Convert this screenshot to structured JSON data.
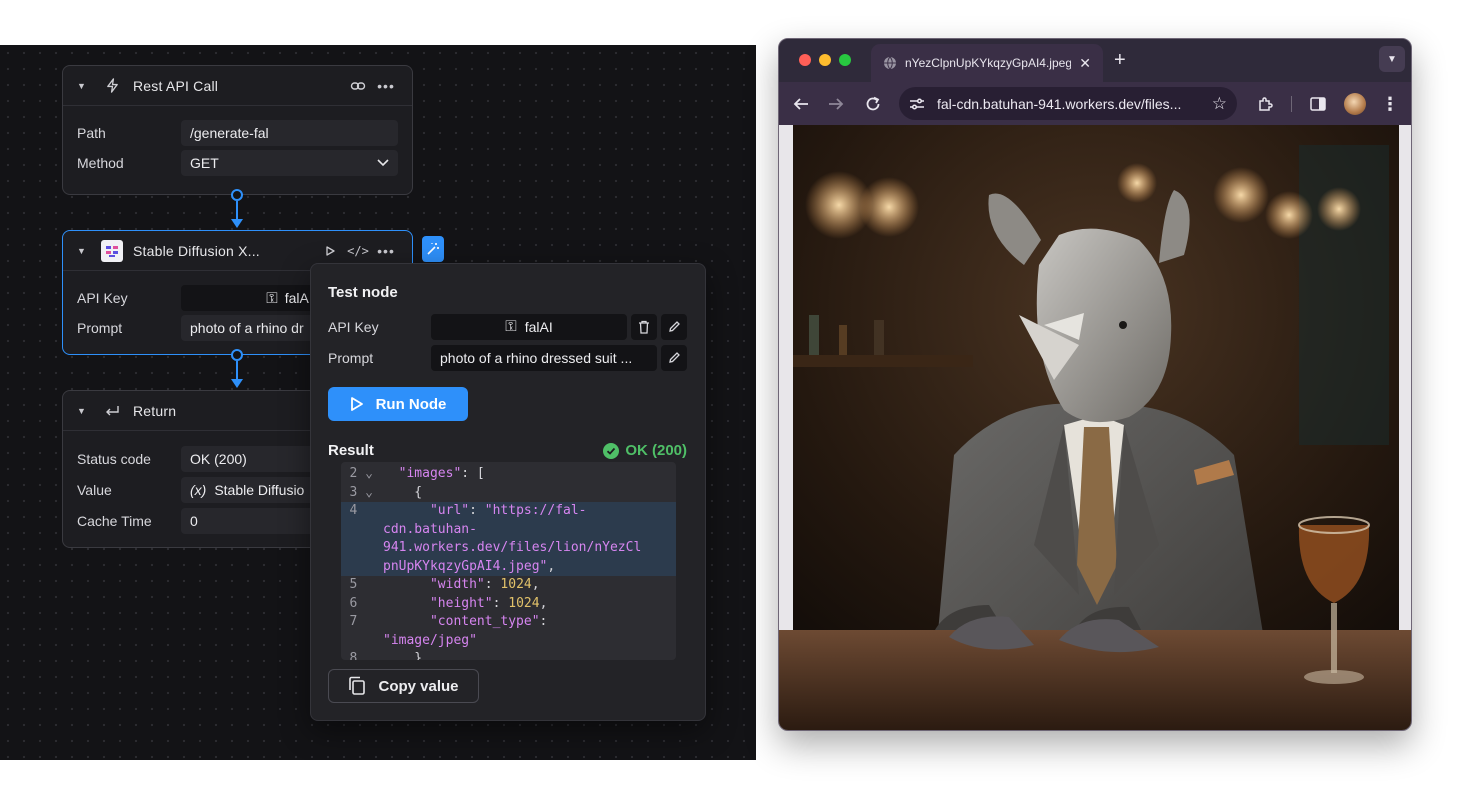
{
  "editor": {
    "rest_node": {
      "title": "Rest API Call",
      "fields": {
        "path_label": "Path",
        "path_value": "/generate-fal",
        "method_label": "Method",
        "method_value": "GET"
      }
    },
    "sd_node": {
      "title": "Stable Diffusion X...",
      "fields": {
        "apikey_label": "API Key",
        "apikey_value": "falAI",
        "prompt_label": "Prompt",
        "prompt_value": "photo of a rhino dr"
      }
    },
    "return_node": {
      "title": "Return",
      "fields": {
        "status_label": "Status code",
        "status_value": "OK (200)",
        "value_label": "Value",
        "value_value": "Stable Diffusio",
        "cache_label": "Cache Time",
        "cache_value": "0"
      }
    }
  },
  "test_panel": {
    "title": "Test node",
    "apikey_label": "API Key",
    "apikey_value": "falAI",
    "prompt_label": "Prompt",
    "prompt_value": "photo of a rhino dressed suit ...",
    "run_label": "Run Node",
    "result_label": "Result",
    "status": "OK (200)",
    "copy_label": "Copy value",
    "code_lines": [
      {
        "n": "2",
        "fold": true,
        "parts": [
          [
            "p",
            "  "
          ],
          [
            "k",
            "\"images\""
          ],
          [
            "p",
            ": ["
          ]
        ]
      },
      {
        "n": "3",
        "fold": true,
        "parts": [
          [
            "p",
            "    {"
          ]
        ]
      },
      {
        "n": "4",
        "parts": [
          [
            "p",
            "      "
          ],
          [
            "k",
            "\"url\""
          ],
          [
            "p",
            ": "
          ],
          [
            "s",
            "\"https://fal-"
          ]
        ],
        "hl": true
      },
      {
        "n": "",
        "parts": [
          [
            "s",
            "cdn.batuhan-"
          ]
        ],
        "hl": true
      },
      {
        "n": "",
        "parts": [
          [
            "s",
            "941.workers.dev/files/lion/nYezCl"
          ]
        ],
        "hl": true
      },
      {
        "n": "",
        "parts": [
          [
            "s",
            "pnUpKYkqzyGpAI4.jpeg\""
          ],
          [
            "p",
            ","
          ]
        ],
        "hl": true
      },
      {
        "n": "5",
        "parts": [
          [
            "p",
            "      "
          ],
          [
            "k",
            "\"width\""
          ],
          [
            "p",
            ": "
          ],
          [
            "n",
            "1024"
          ],
          [
            "p",
            ","
          ]
        ]
      },
      {
        "n": "6",
        "parts": [
          [
            "p",
            "      "
          ],
          [
            "k",
            "\"height\""
          ],
          [
            "p",
            ": "
          ],
          [
            "n",
            "1024"
          ],
          [
            "p",
            ","
          ]
        ]
      },
      {
        "n": "7",
        "parts": [
          [
            "p",
            "      "
          ],
          [
            "k",
            "\"content_type\""
          ],
          [
            "p",
            ":"
          ]
        ]
      },
      {
        "n": "",
        "parts": [
          [
            "s",
            "\"image/jpeg\""
          ]
        ]
      },
      {
        "n": "8",
        "parts": [
          [
            "p",
            "    }"
          ]
        ]
      }
    ]
  },
  "browser": {
    "tab_title": "nYezClpnUpKYkqzyGpAI4.jpeg",
    "url": "fal-cdn.batuhan-941.workers.dev/files...",
    "colors": {
      "close": "#ff5f57",
      "minimize": "#febc2e",
      "maximize": "#28c840"
    }
  },
  "colors": {
    "accent": "#2e90fa",
    "success": "#4fbf67",
    "string": "#d685f0",
    "number": "#e2c26a"
  }
}
